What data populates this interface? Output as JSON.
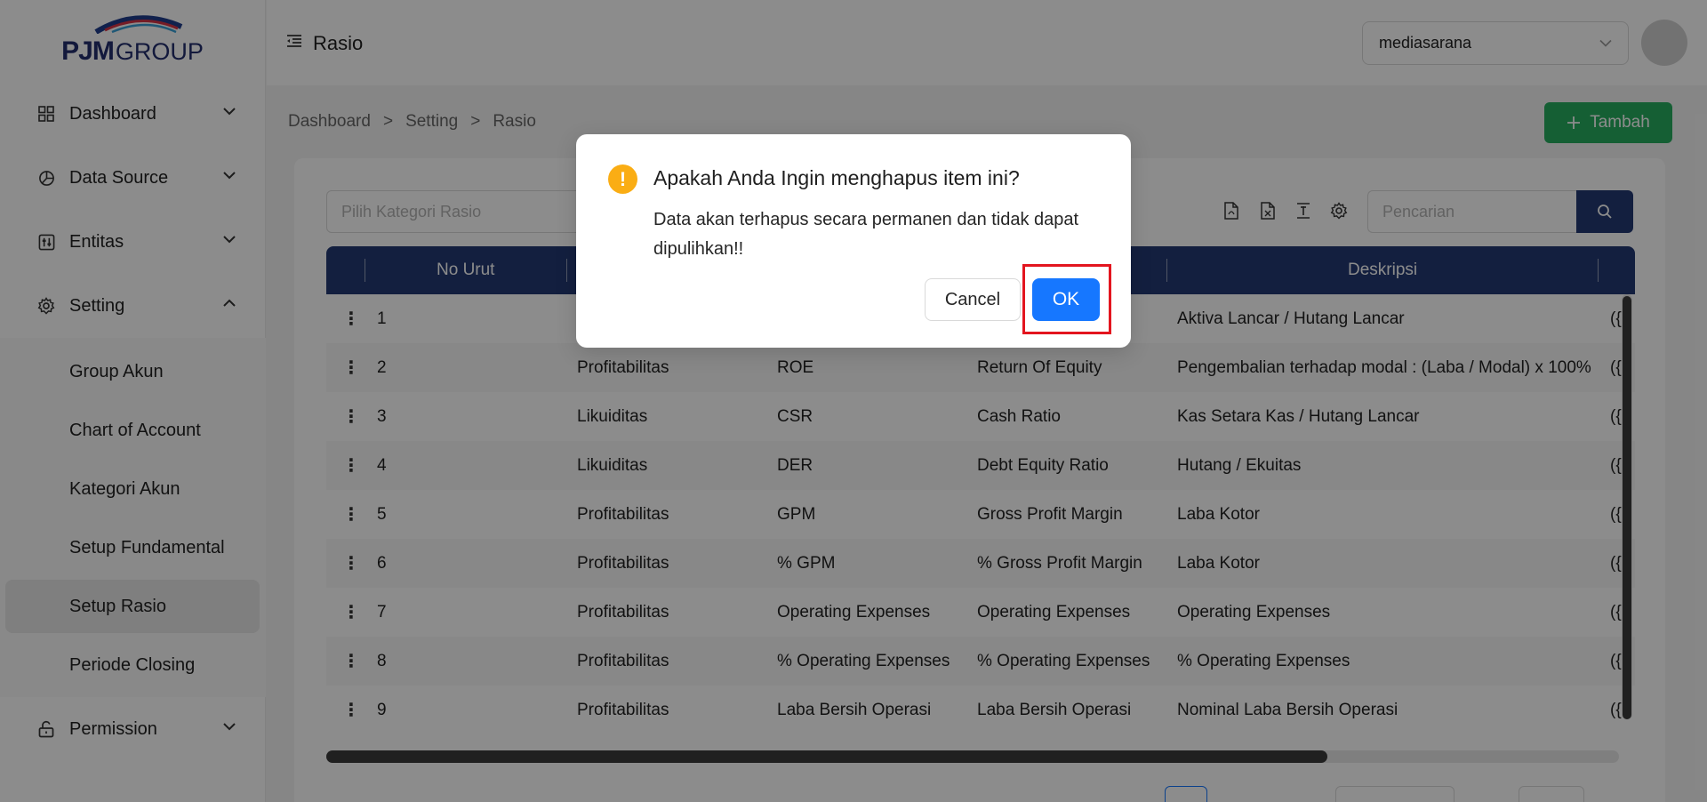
{
  "brand": {
    "logo_bold": "PJM",
    "logo_rest": "GROUP"
  },
  "sidebar": {
    "items": [
      {
        "label": "Dashboard",
        "icon": "dashboard-icon"
      },
      {
        "label": "Data Source",
        "icon": "pie-chart-icon"
      },
      {
        "label": "Entitas",
        "icon": "sliders-icon"
      },
      {
        "label": "Setting",
        "icon": "gear-icon",
        "expanded": true
      },
      {
        "label": "Permission",
        "icon": "unlock-icon"
      }
    ],
    "submenu": [
      {
        "label": "Group Akun"
      },
      {
        "label": "Chart of Account"
      },
      {
        "label": "Kategori Akun"
      },
      {
        "label": "Setup Fundamental"
      },
      {
        "label": "Setup Rasio",
        "active": true
      },
      {
        "label": "Periode Closing"
      }
    ]
  },
  "header": {
    "title": "Rasio",
    "org_value": "mediasarana"
  },
  "breadcrumb": {
    "items": [
      "Dashboard",
      "Setting",
      "Rasio"
    ],
    "separator": ">"
  },
  "toolbar": {
    "add_label": "Tambah",
    "category_placeholder": "Pilih Kategori Rasio",
    "search_placeholder": "Pencarian"
  },
  "table": {
    "headers": {
      "no": "No Urut",
      "desc": "Deskripsi"
    },
    "rows": [
      {
        "no": "1",
        "cat": "",
        "code": "",
        "name": "",
        "desc": "Aktiva Lancar / Hutang Lancar"
      },
      {
        "no": "2",
        "cat": "Profitabilitas",
        "code": "ROE",
        "name": "Return Of Equity",
        "desc": "Pengembalian terhadap modal : (Laba / Modal) x 100%"
      },
      {
        "no": "3",
        "cat": "Likuiditas",
        "code": "CSR",
        "name": "Cash Ratio",
        "desc": "Kas Setara Kas / Hutang Lancar"
      },
      {
        "no": "4",
        "cat": "Likuiditas",
        "code": "DER",
        "name": "Debt Equity Ratio",
        "desc": "Hutang / Ekuitas"
      },
      {
        "no": "5",
        "cat": "Profitabilitas",
        "code": "GPM",
        "name": "Gross Profit Margin",
        "desc": "Laba Kotor"
      },
      {
        "no": "6",
        "cat": "Profitabilitas",
        "code": "% GPM",
        "name": "% Gross Profit Margin",
        "desc": "Laba Kotor"
      },
      {
        "no": "7",
        "cat": "Profitabilitas",
        "code": "Operating Expenses",
        "name": "Operating Expenses",
        "desc": "Operating Expenses"
      },
      {
        "no": "8",
        "cat": "Profitabilitas",
        "code": "% Operating Expenses",
        "name": "% Operating Expenses",
        "desc": "% Operating Expenses"
      },
      {
        "no": "9",
        "cat": "Profitabilitas",
        "code": "Laba Bersih Operasi",
        "name": "Laba Bersih Operasi",
        "desc": "Nominal Laba Bersih Operasi"
      }
    ],
    "formula_prefix": "({"
  },
  "modal": {
    "title": "Apakah Anda Ingin menghapus item ini?",
    "body": "Data akan terhapus secara permanen dan tidak dapat dipulihkan!!",
    "icon": "!",
    "cancel_label": "Cancel",
    "ok_label": "OK"
  },
  "colors": {
    "primary_navy": "#243a73",
    "add_green": "#27ae60",
    "ok_blue": "#1677ff",
    "warning": "#faad14",
    "highlight_red": "#e3151f"
  }
}
